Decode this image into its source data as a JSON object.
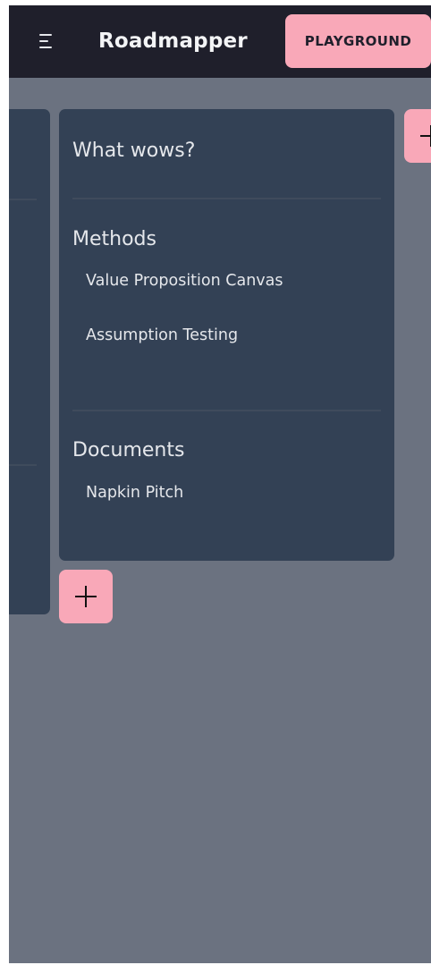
{
  "header": {
    "app_title": "Roadmapper",
    "playground_label": "PLAYGROUND",
    "menu_icon": "menu-icon"
  },
  "card": {
    "title": "What wows?",
    "methods": {
      "heading": "Methods",
      "items": [
        "Value Proposition Canvas",
        "Assumption Testing"
      ]
    },
    "documents": {
      "heading": "Documents",
      "items": [
        "Napkin Pitch"
      ]
    }
  },
  "add_buttons": {
    "icon": "plus-icon"
  },
  "colors": {
    "topbar": "#1f1f2b",
    "background": "#6b7280",
    "card": "#334155",
    "accent": "#f9a8b8"
  }
}
